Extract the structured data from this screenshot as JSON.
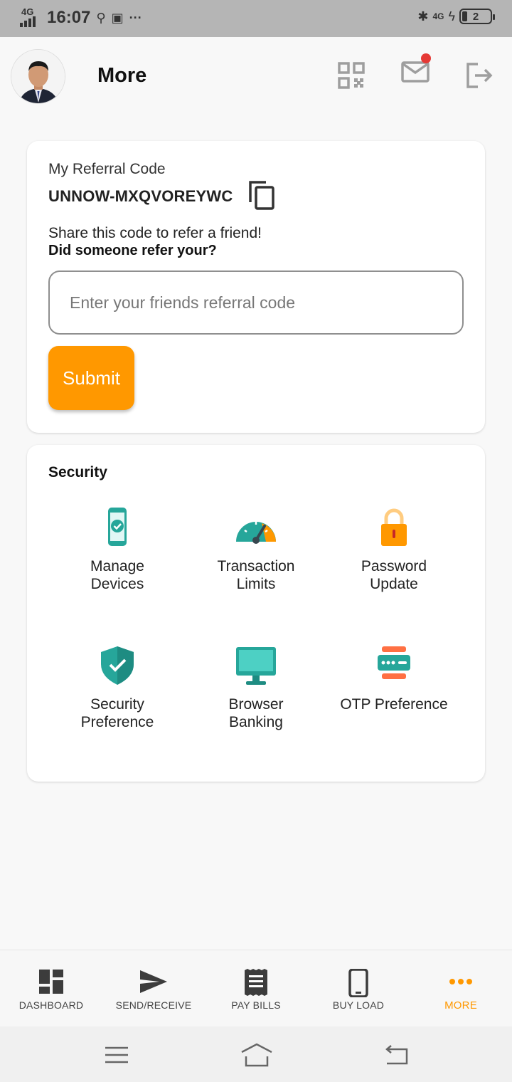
{
  "status_bar": {
    "network": "4G",
    "time": "16:07",
    "extra": "···",
    "right_network": "4G",
    "battery": "2"
  },
  "header": {
    "title": "More"
  },
  "referral": {
    "label": "My Referral Code",
    "code": "UNNOW-MXQVOREYWC",
    "share_text": "Share this code to refer a friend!",
    "ask_text": "Did someone refer your?",
    "input_placeholder": "Enter your friends referral code",
    "input_value": "",
    "submit_label": "Submit"
  },
  "security": {
    "title": "Security",
    "items": [
      {
        "line1": "Manage",
        "line2": "Devices",
        "icon": "phone-check-icon"
      },
      {
        "line1": "Transaction",
        "line2": "Limits",
        "icon": "speedometer-icon"
      },
      {
        "line1": "Password",
        "line2": "Update",
        "icon": "lock-icon"
      },
      {
        "line1": "Security",
        "line2": "Preference",
        "icon": "shield-check-icon"
      },
      {
        "line1": "Browser",
        "line2": "Banking",
        "icon": "monitor-icon"
      },
      {
        "line1": "OTP Preference",
        "line2": "",
        "icon": "otp-icon"
      }
    ]
  },
  "bottom_nav": {
    "items": [
      {
        "label": "DASHBOARD",
        "icon": "dashboard-icon"
      },
      {
        "label": "SEND/RECEIVE",
        "icon": "send-icon"
      },
      {
        "label": "PAY BILLS",
        "icon": "receipt-icon"
      },
      {
        "label": "BUY LOAD",
        "icon": "mobile-icon"
      },
      {
        "label": "MORE",
        "icon": "more-dots-icon"
      }
    ],
    "active": "MORE"
  },
  "colors": {
    "accent": "#ff9800",
    "teal": "#26a69a",
    "notification": "#e53935",
    "status_bar": "#b5b5b5"
  }
}
